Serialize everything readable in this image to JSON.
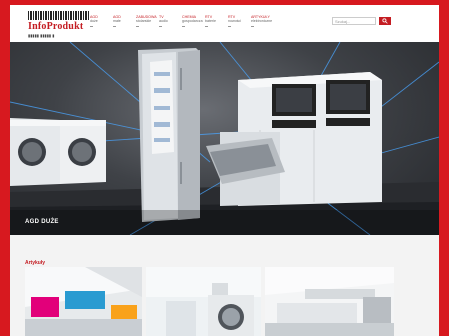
{
  "logo": {
    "name": "InfoProdukt",
    "tagline": "▮▮▮▮▮ ▮▮▮▮▮ ▮"
  },
  "nav": [
    {
      "title": "AGD",
      "sub": "duże"
    },
    {
      "title": "AGD",
      "sub": "małe"
    },
    {
      "title": "Zabudowa",
      "sub": "stolarskie"
    },
    {
      "title": "TV",
      "sub": "audio"
    },
    {
      "title": "Chemia",
      "sub": "gospodarcza"
    },
    {
      "title": "RTV",
      "sub": "baterie"
    },
    {
      "title": "RTV",
      "sub": "nowości"
    },
    {
      "title": "Artykuły",
      "sub": "elektroniczne"
    }
  ],
  "search": {
    "placeholder": "Szukaj..."
  },
  "hero": {
    "label": "AGD DUŻE"
  },
  "articles": {
    "title": "Artykuły"
  },
  "colors": {
    "brand": "#d7191f",
    "accent": "#c41c22"
  }
}
